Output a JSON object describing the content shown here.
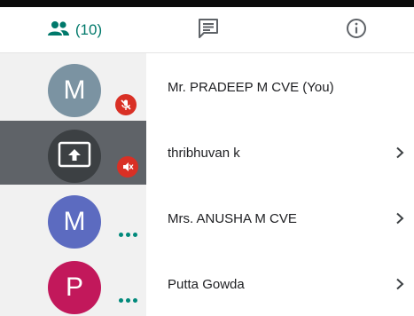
{
  "tabs": {
    "people_count": "(10)",
    "active_tab": "people"
  },
  "colors": {
    "accent": "#00796b",
    "mute_badge": "#d93025",
    "presenting_tile": "#5f6368"
  },
  "participants": [
    {
      "initial": "M",
      "avatar_color": "#7b93a2",
      "name": "Mr. PRADEEP M CVE (You)",
      "mic": "muted",
      "has_chevron": false
    },
    {
      "initial": "",
      "avatar_color": "#3c4043",
      "name": "thribhuvan k",
      "mic": "muted",
      "presenting": true,
      "has_chevron": true
    },
    {
      "initial": "M",
      "avatar_color": "#5c6bc0",
      "name": "Mrs. ANUSHA M CVE",
      "mic": "speaking-dots",
      "has_chevron": true
    },
    {
      "initial": "P",
      "avatar_color": "#c2185b",
      "name": "Putta Gowda",
      "mic": "speaking-dots",
      "has_chevron": true
    }
  ]
}
